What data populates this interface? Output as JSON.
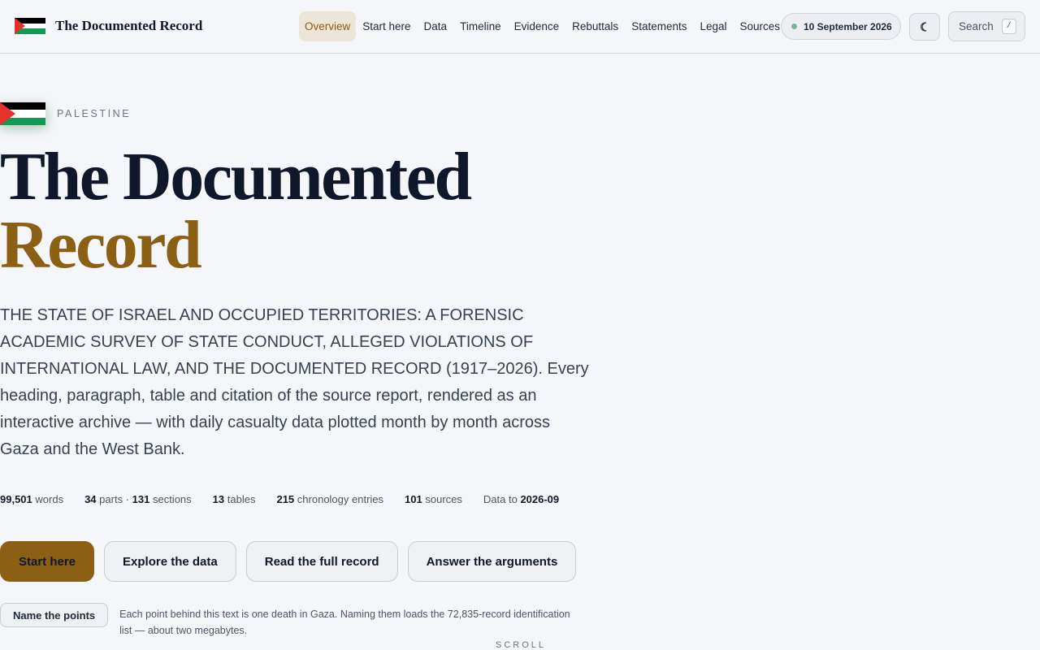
{
  "brand": {
    "title": "The Documented Record",
    "flag_colors": {
      "black": "#000000",
      "white": "#ffffff",
      "green": "#149954",
      "red": "#e4312b"
    }
  },
  "nav": {
    "items": [
      {
        "label": "Overview",
        "active": true
      },
      {
        "label": "Start here",
        "active": false
      },
      {
        "label": "Data",
        "active": false
      },
      {
        "label": "Timeline",
        "active": false
      },
      {
        "label": "Evidence",
        "active": false
      },
      {
        "label": "Rebuttals",
        "active": false
      },
      {
        "label": "Statements",
        "active": false
      },
      {
        "label": "Legal",
        "active": false
      },
      {
        "label": "Sources",
        "active": false
      }
    ]
  },
  "status": {
    "date": "10 September 2026"
  },
  "theme_toggle": {
    "glyph": "☾",
    "icon": "moon-icon"
  },
  "search": {
    "label": "Search",
    "shortcut": "/"
  },
  "hero": {
    "kicker": "PALESTINE",
    "title_line1": "The Documented",
    "title_line2": "Record",
    "description": "THE STATE OF ISRAEL AND OCCUPIED TERRITORIES: A FORENSIC ACADEMIC SURVEY OF STATE CONDUCT, ALLEGED VIOLATIONS OF INTERNATIONAL LAW, AND THE DOCUMENTED RECORD (1917–2026). Every heading, paragraph, table and citation of the source report, rendered as an interactive archive — with daily casualty data plotted month by month across Gaza and the West Bank."
  },
  "stats": {
    "words_value": "99,501",
    "words_label": "words",
    "parts_value": "34",
    "parts_label": "parts ·",
    "sections_value": "131",
    "sections_label": "sections",
    "tables_value": "13",
    "tables_label": "tables",
    "chronology_value": "215",
    "chronology_label": "chronology entries",
    "sources_value": "101",
    "sources_label": "sources",
    "data_to_label": "Data to",
    "data_to_value": "2026-09"
  },
  "actions": {
    "start": "Start here",
    "explore": "Explore the data",
    "read": "Read the full record",
    "answer": "Answer the arguments"
  },
  "points": {
    "button": "Name the points",
    "note": "Each point behind this text is one death in Gaza. Naming them loads the 72,835-record identification list — about two megabytes."
  },
  "scroll_hint": "SCROLL",
  "colors": {
    "accent": "#8b5f14",
    "background": "#f5f6fa",
    "status_dot": "#7fb596"
  }
}
